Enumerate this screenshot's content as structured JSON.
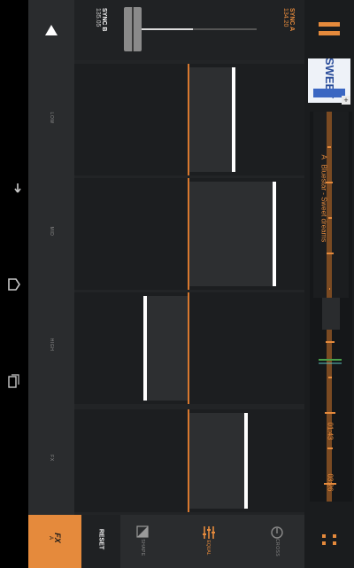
{
  "sync": {
    "a_label": "SYNC A",
    "a_bpm": "134.20",
    "b_label": "SYNC B",
    "b_bpm": "135.05"
  },
  "track": {
    "deck": "A",
    "title": "Bluestar - Sweet dreams",
    "elapsed": "01:43",
    "total": "03:26"
  },
  "toolbar": {
    "fx_label": "FX",
    "fx_sub": "A",
    "reset_label": "RESET",
    "shape_label": "SHAPE",
    "equal_label": "EQUAL",
    "cross_label": "CROSS"
  },
  "pads": {
    "labels": [
      "LOW",
      "MID",
      "HIGH",
      "FX"
    ],
    "positions": [
      0.8,
      0.95,
      0.2,
      0.7
    ]
  },
  "colors": {
    "accent": "#e58a3c",
    "marker": "#d8782f",
    "bg": "#222426"
  },
  "icons": [
    "back-icon",
    "home-icon",
    "recents-icon",
    "eject-icon",
    "pause-icon",
    "expand-icon",
    "chevron-icon"
  ]
}
